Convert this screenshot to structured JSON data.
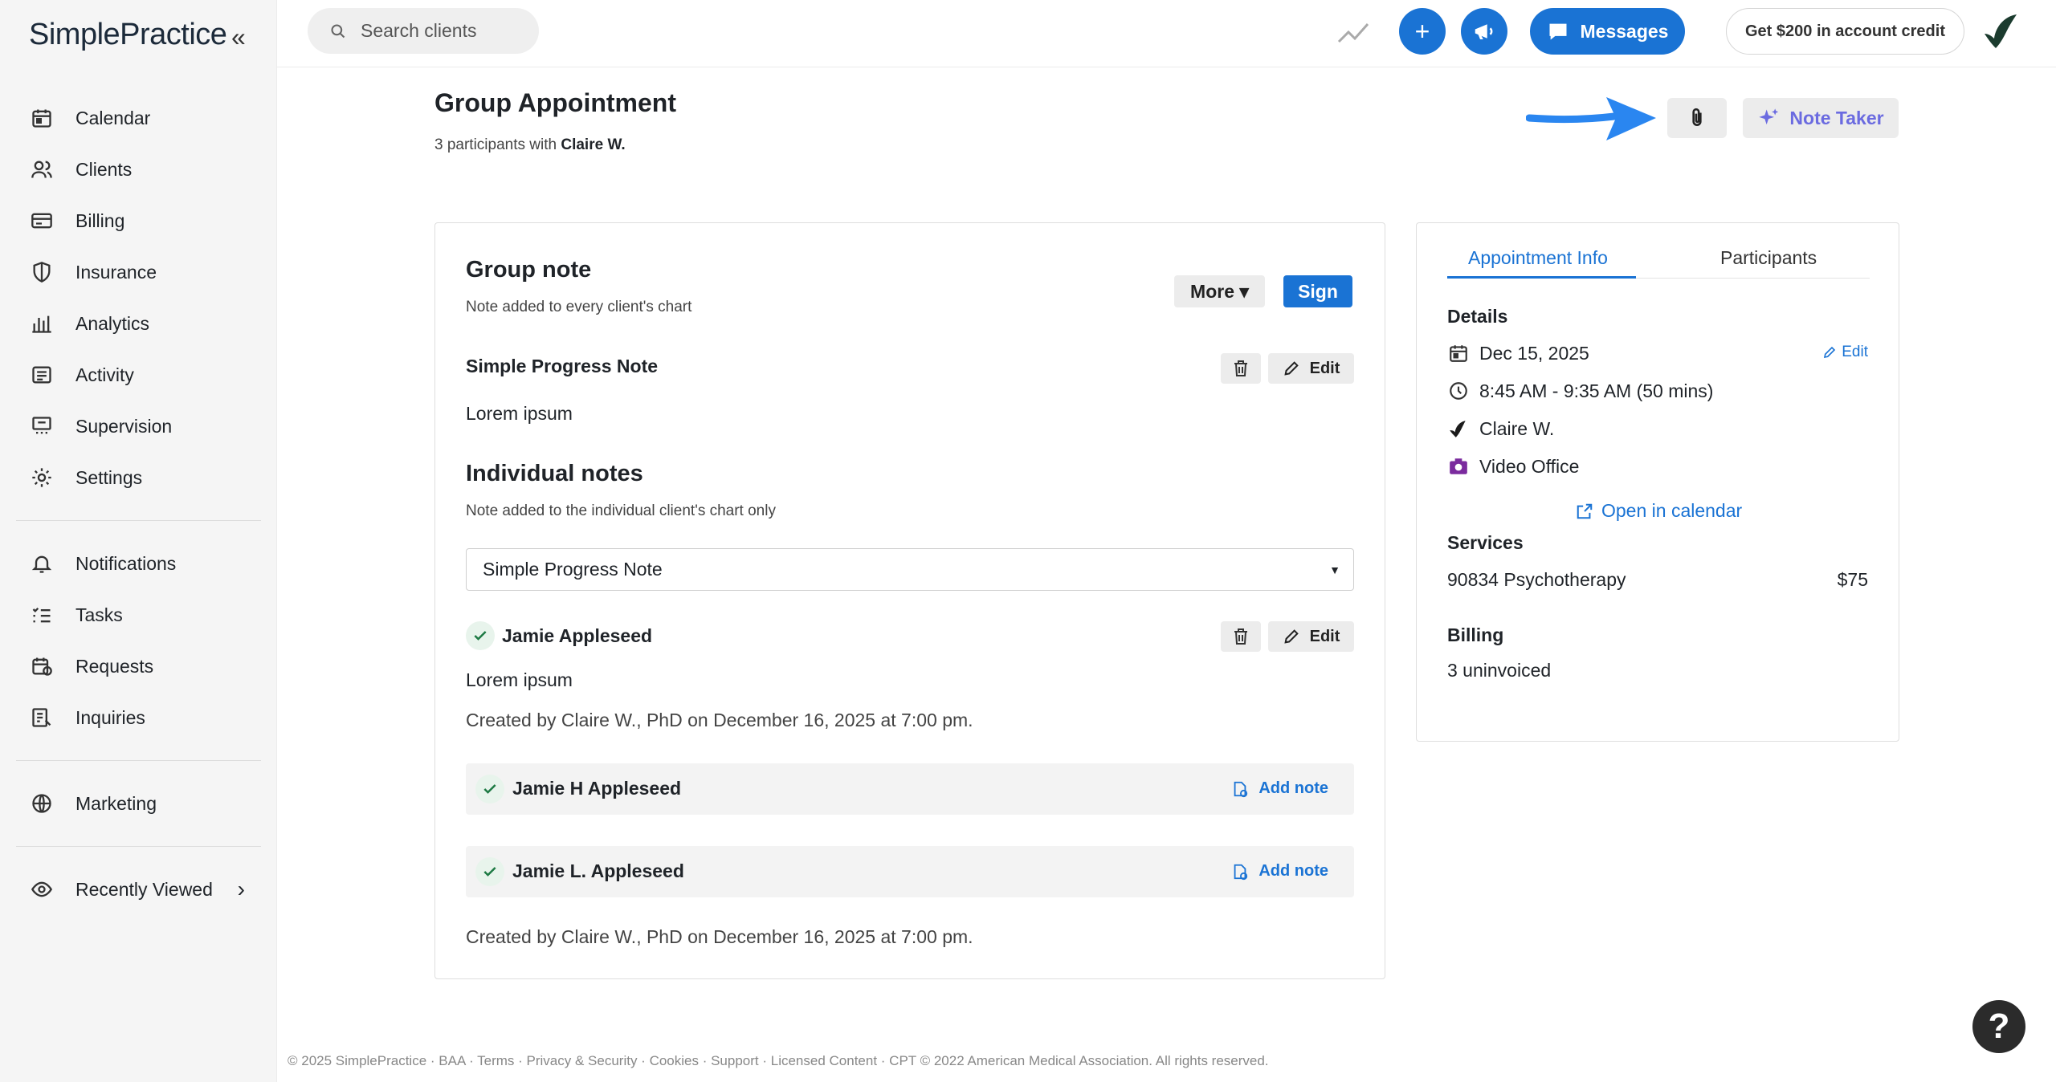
{
  "brand": {
    "logo_text": "SimplePractice",
    "collapse_glyph": "«"
  },
  "sidebar": {
    "items": [
      {
        "label": "Calendar",
        "icon": "calendar-icon"
      },
      {
        "label": "Clients",
        "icon": "users-icon"
      },
      {
        "label": "Billing",
        "icon": "credit-card-icon"
      },
      {
        "label": "Insurance",
        "icon": "shield-icon"
      },
      {
        "label": "Analytics",
        "icon": "bar-chart-icon"
      },
      {
        "label": "Activity",
        "icon": "list-icon"
      },
      {
        "label": "Supervision",
        "icon": "supervision-icon"
      },
      {
        "label": "Settings",
        "icon": "gear-icon"
      }
    ],
    "items2": [
      {
        "label": "Notifications",
        "icon": "bell-icon"
      },
      {
        "label": "Tasks",
        "icon": "checklist-icon"
      },
      {
        "label": "Requests",
        "icon": "calendar-clock-icon"
      },
      {
        "label": "Inquiries",
        "icon": "inquiry-icon"
      }
    ],
    "marketing": {
      "label": "Marketing",
      "icon": "globe-icon"
    },
    "recently_viewed": {
      "label": "Recently Viewed",
      "icon": "eye-icon",
      "arrow": "›"
    }
  },
  "topbar": {
    "search_placeholder": "Search clients",
    "plus_glyph": "+",
    "messages_label": "Messages",
    "credit_label": "Get $200 in account credit"
  },
  "page": {
    "title": "Group Appointment",
    "subtitle_prefix": "3 participants with ",
    "subtitle_name": "Claire W.",
    "note_taker_label": "Note Taker"
  },
  "group_note": {
    "title": "Group note",
    "subtitle": "Note added to every client's chart",
    "more_label": "More ▾",
    "sign_label": "Sign",
    "note_type": "Simple Progress Note",
    "edit_label": "Edit",
    "content": "Lorem ipsum"
  },
  "individual_notes": {
    "title": "Individual notes",
    "subtitle": "Note added to the individual client's chart only",
    "select_value": "Simple Progress Note",
    "caret": "▼",
    "first": {
      "name": "Jamie Appleseed",
      "edit_label": "Edit",
      "content": "Lorem ipsum",
      "created": "Created by Claire W., PhD on December 16, 2025 at 7:00 pm."
    },
    "rows": [
      {
        "name": "Jamie H Appleseed",
        "action": "Add note"
      },
      {
        "name": "Jamie L. Appleseed",
        "action": "Add note"
      }
    ],
    "footer_created": "Created by Claire W., PhD on December 16, 2025 at 7:00 pm."
  },
  "side": {
    "tabs": [
      "Appointment Info",
      "Participants"
    ],
    "details_head": "Details",
    "edit_label": "Edit",
    "date": "Dec 15, 2025",
    "time": "8:45 AM - 9:35 AM (50 mins)",
    "clinician": "Claire W.",
    "location": "Video Office",
    "open_calendar": "Open in calendar",
    "services_head": "Services",
    "service_name": "90834 Psychotherapy",
    "service_price": "$75",
    "billing_head": "Billing",
    "billing_value": "3 uninvoiced"
  },
  "footer": {
    "text": "© 2025 SimplePractice · BAA · Terms · Privacy & Security · Cookies · Support · Licensed Content · CPT © 2022 American Medical Association. All rights reserved."
  },
  "help_glyph": "?",
  "colors": {
    "accent": "#1a73d4",
    "note_taker": "#6b6be0",
    "success": "#1e7a44",
    "video": "#7b2b9e"
  }
}
